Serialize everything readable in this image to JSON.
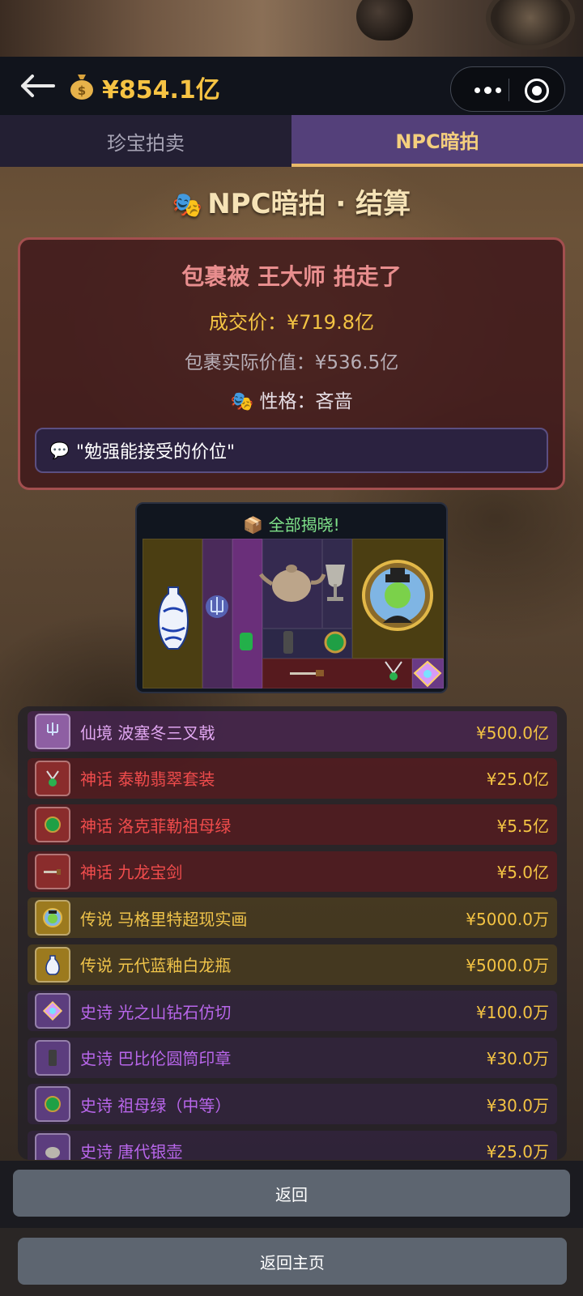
{
  "header": {
    "money_icon": "money-bag-icon",
    "balance": "¥854.1亿"
  },
  "tabs": [
    {
      "label": "珍宝拍卖",
      "active": false
    },
    {
      "label": "NPC暗拍",
      "active": true
    }
  ],
  "page": {
    "heading": "NPC暗拍 · 结算"
  },
  "result": {
    "title": "包裹被 王大师 拍走了",
    "deal_price": "成交价：¥719.8亿",
    "actual_value": "包裹实际价值：¥536.5亿",
    "trait": "性格：吝啬",
    "quote": "\"勉强能接受的价位\""
  },
  "reveal": {
    "title": "全部揭晓!"
  },
  "items": [
    {
      "name": "仙境 波塞冬三叉戟",
      "price": "¥500.0亿",
      "tier": "fairy",
      "icon": "trident-icon"
    },
    {
      "name": "神话 泰勒翡翠套装",
      "price": "¥25.0亿",
      "tier": "myth",
      "icon": "emerald-set-icon"
    },
    {
      "name": "神话 洛克菲勒祖母绿",
      "price": "¥5.5亿",
      "tier": "myth",
      "icon": "emerald-icon"
    },
    {
      "name": "神话 九龙宝剑",
      "price": "¥5.0亿",
      "tier": "myth",
      "icon": "sword-icon"
    },
    {
      "name": "传说 马格里特超现实画",
      "price": "¥5000.0万",
      "tier": "legend",
      "icon": "painting-icon"
    },
    {
      "name": "传说 元代蓝釉白龙瓶",
      "price": "¥5000.0万",
      "tier": "legend",
      "icon": "vase-icon"
    },
    {
      "name": "史诗 光之山钻石仿切",
      "price": "¥100.0万",
      "tier": "epic",
      "icon": "diamond-icon"
    },
    {
      "name": "史诗 巴比伦圆筒印章",
      "price": "¥30.0万",
      "tier": "epic",
      "icon": "cylinder-seal-icon"
    },
    {
      "name": "史诗 祖母绿（中等）",
      "price": "¥30.0万",
      "tier": "epic",
      "icon": "emerald-icon"
    },
    {
      "name": "史诗 唐代银壶",
      "price": "¥25.0万",
      "tier": "epic",
      "icon": "silver-pot-icon"
    }
  ],
  "tier_colors": {
    "fairy": "#e0a6f0",
    "myth": "#f04c4c",
    "legend": "#f0c44a",
    "epic": "#b866ea"
  },
  "buttons": {
    "back": "返回",
    "home": "返回主页"
  }
}
